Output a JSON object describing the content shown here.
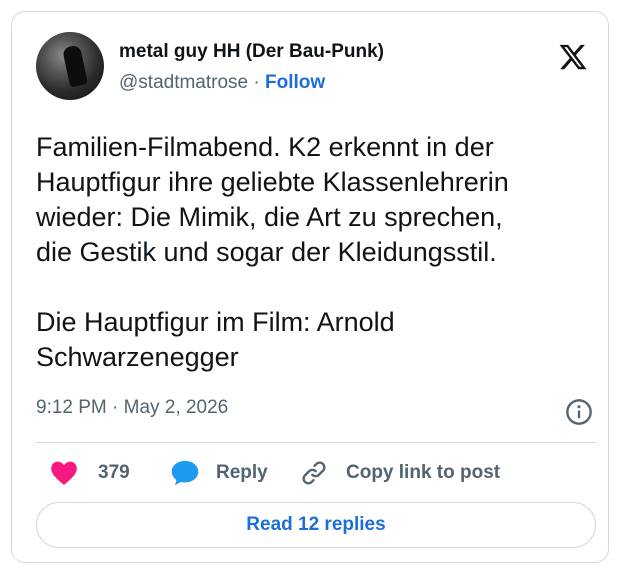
{
  "author": {
    "name": "metal guy HH (Der Bau-Punk)",
    "handle": "@stadtmatrose",
    "separator": "·",
    "follow_label": "Follow"
  },
  "platform_icon": "x-logo-icon",
  "tweet": {
    "text": "Familien-Filmabend. K2 erkennt in der\nHauptfigur ihre geliebte Klassenlehrerin\nwieder: Die Mimik, die Art zu sprechen,\ndie Gestik und sogar der Kleidungsstil.\n\nDie Hauptfigur im Film: Arnold\nSchwarzenegger",
    "timestamp": "9:12 PM · May 2, 2026"
  },
  "actions": {
    "like_count": "379",
    "reply_label": "Reply",
    "copy_label": "Copy link to post"
  },
  "read_replies_label": "Read 12 replies",
  "colors": {
    "like": "#f91880",
    "reply": "#1d9bf0",
    "link": "#1d6fd8",
    "muted": "#536471",
    "border": "#cfd9de"
  }
}
